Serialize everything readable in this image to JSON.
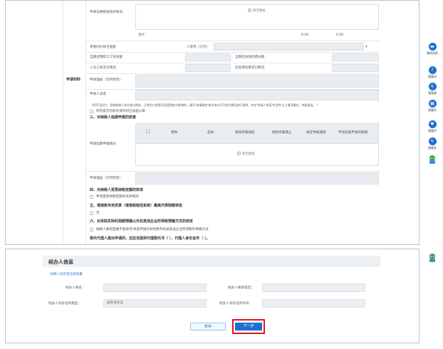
{
  "top": {
    "r1_label": "申请证明相关购买情况",
    "no_data": "暂无数据",
    "total_label": "合计：",
    "total_v1": "0.00",
    "total_v2": "0.00",
    "r3_label": "有限的价款合金额",
    "r3_mid": "人民币（大写）",
    "r3_right": "¥",
    "r4_left": "当期适用职工工资总额",
    "r4_right": "当期社会保险费总额",
    "r5_left": "人员工资支付情况",
    "r5_right": "社会保险费支付情况",
    "section_label": "申请材料",
    "r6_label": "申请理由（可另附页）",
    "r7_label": "申请人承诺",
    "notice": "（如不可抗力，导致纳税人发生较大损失，正常生产经营活动受到较大影响的，填写'申请理由'和次年内不可抗力情况进行说明，并在'申请人承诺'中注明'以上情况属实，特此承诺。'）",
    "check1": "所有提交的财务资料均已加盖公章",
    "sec3_title": "三、对纳税人延期申报的核查",
    "table_label": "申请延期申报情况",
    "cols": [
      "税种",
      "品目",
      "税款所属期起",
      "税款所属期止",
      "规定申报期限",
      "申请延期申报的期限"
    ],
    "r9_label": "申请理由（可另附页）",
    "sec4_title": "四、对纳税人变更纳税定额的核准",
    "sec4_check": "申请变更纳税定额的具体情况",
    "sec5_title": "五、增值税专用发票（增值税税控系统）最高开票限额审批",
    "sec5_check": "无",
    "sec6_title": "六、对采取实际利润额预缴以外的其他企业所得税预缴方式的核定",
    "sec6_check": "纳税人确有困难不能按月/季度申报的并经税务机关核准企业所得税的预缴方式",
    "footer_line": "委托代理人提出申请的，还应当提供代理委托书（  ）、代理人身份证件（  ）。"
  },
  "sidebar": [
    {
      "label": "我的消息",
      "icon": "message-icon",
      "glyph": "▬"
    },
    {
      "label": "我要问",
      "icon": "question-icon",
      "glyph": "?"
    },
    {
      "label": "我要查",
      "icon": "search-icon",
      "glyph": "⚲"
    },
    {
      "label": "我要约",
      "icon": "calendar-icon",
      "glyph": "▦"
    },
    {
      "label": "我要评",
      "icon": "heart-icon",
      "glyph": "♥"
    },
    {
      "label": "我要办",
      "icon": "edit-icon",
      "glyph": "✎"
    },
    {
      "label": "",
      "icon": "robot-icon",
      "glyph": ""
    }
  ],
  "bottom": {
    "header": "经办人信息",
    "link": "办税人员实名信息采集",
    "name_label": "经办人姓名：",
    "phone_label": "经办人联系电话：",
    "idtype_label": "经办人身份证件类型：",
    "idtype_value": "居民身份证",
    "idno_label": "经办人身份证件号码：",
    "save_label": "暂存",
    "next_label": "下一步"
  },
  "colors": {
    "accent": "#1d6fd0",
    "highlight": "#e0141e"
  }
}
